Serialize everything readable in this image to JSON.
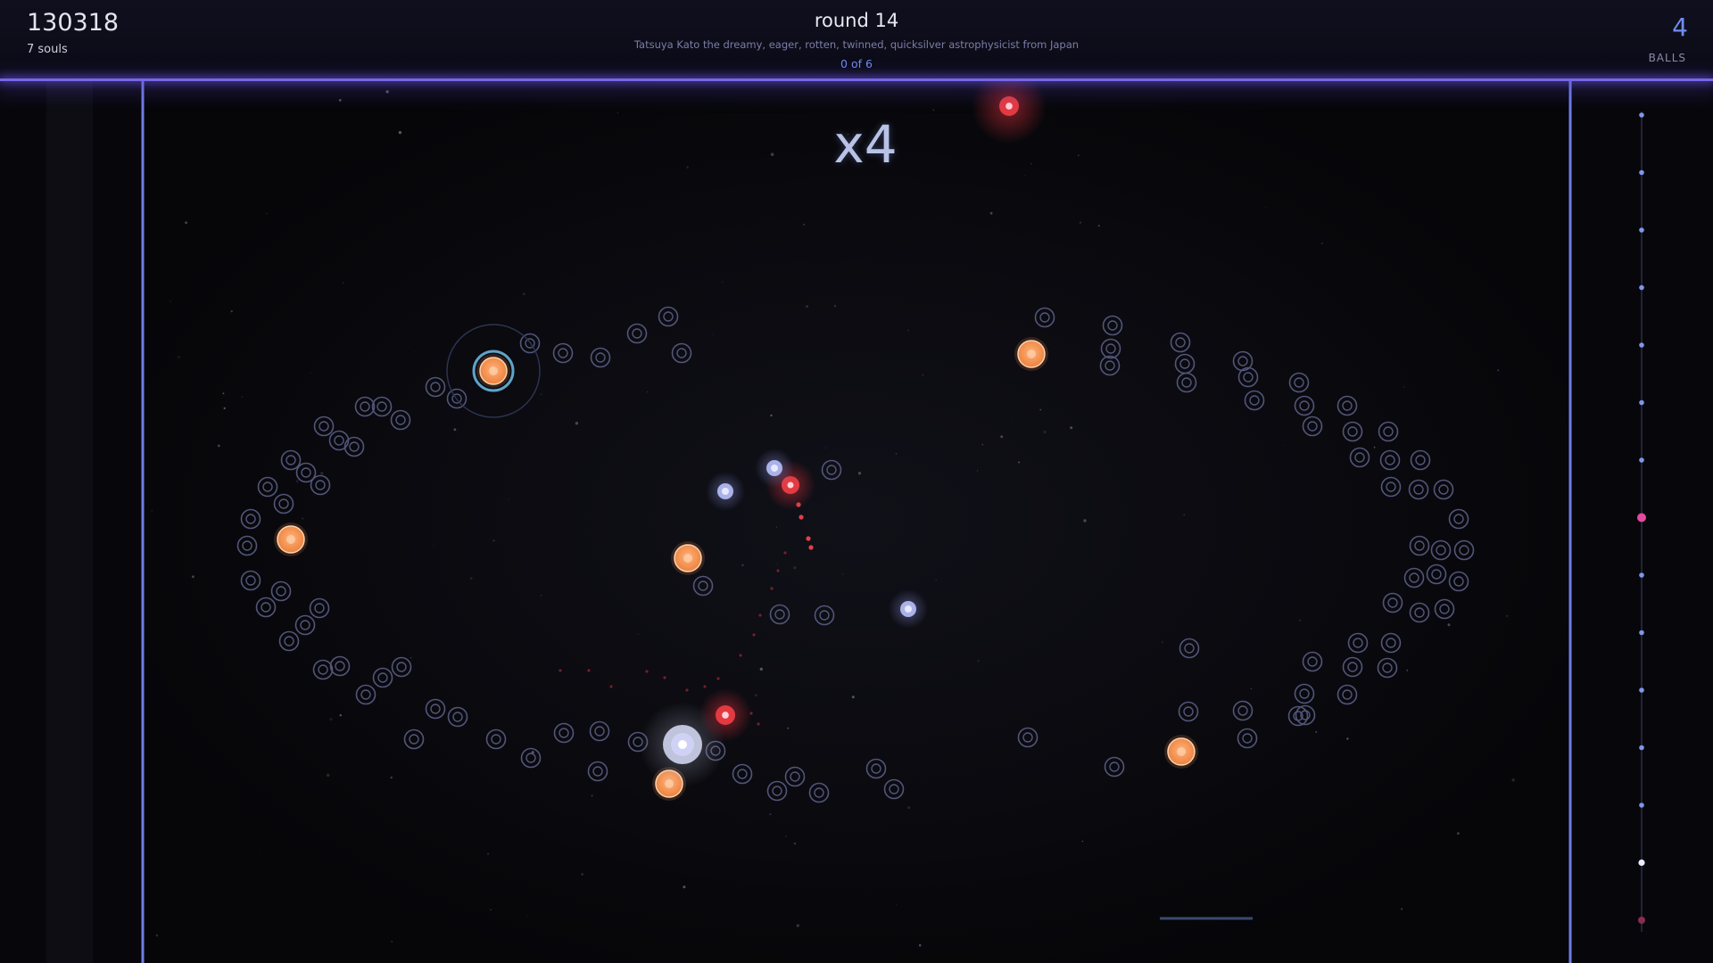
{
  "hud": {
    "score": "130318",
    "souls": "7 souls",
    "round_title": "round 14",
    "round_subtitle": "Tatsuya Kato the dreamy, eager, rotten, twinned, quicksilver astrophysicist from Japan",
    "round_progress": "0 of 6",
    "balls_count": "4",
    "balls_label": "BALLS"
  },
  "field": {
    "multiplier": "x4"
  },
  "colors": {
    "accent": "#7866e6",
    "blue_text": "#6f8df0",
    "peg_ring": "#52567a",
    "orange_peg": "#f2924e",
    "red_ball": "#e33a42",
    "white_ball": "#cfd2f4",
    "background": "#07070b"
  },
  "icons": {
    "peg": "ring-peg-icon",
    "target": "orange-target-icon",
    "hazard": "red-ball-icon",
    "player": "white-ball-icon"
  }
}
